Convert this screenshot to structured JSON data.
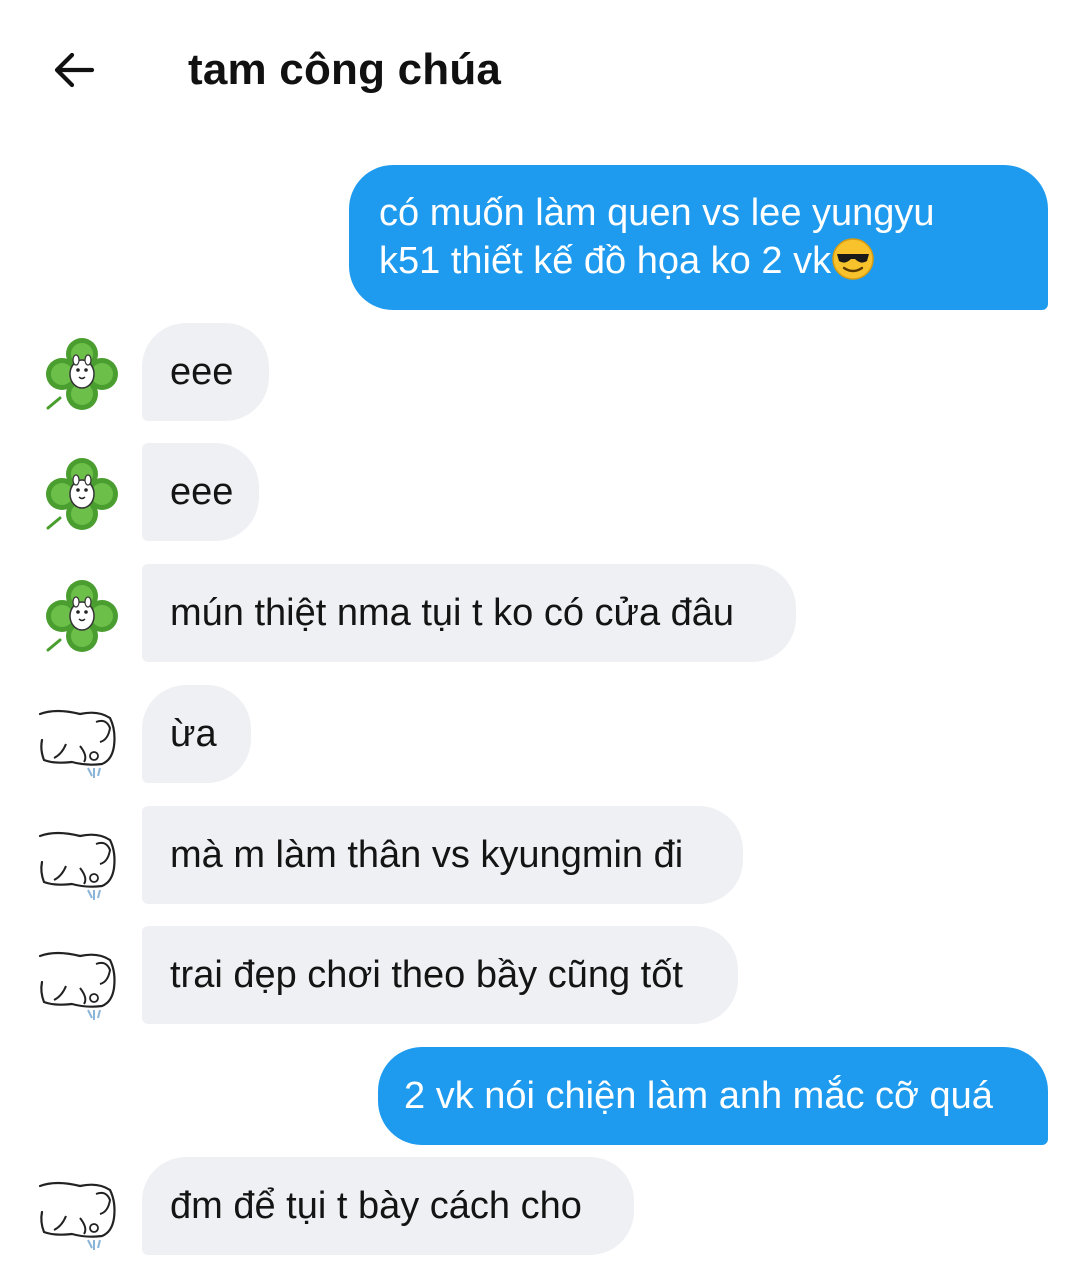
{
  "header": {
    "title": "tam công chúa",
    "back_icon": "arrow-left-icon"
  },
  "messages": [
    {
      "direction": "outgoing",
      "lines": [
        "có muốn làm quen vs lee yungyu",
        "k51 thiết kế đồ họa ko 2 vk"
      ],
      "emoji": "smiling-face-with-sunglasses"
    },
    {
      "direction": "incoming",
      "sender_avatar": "clover-avatar",
      "text": "eee"
    },
    {
      "direction": "incoming",
      "sender_avatar": "clover-avatar",
      "text": "eee"
    },
    {
      "direction": "incoming",
      "sender_avatar": "clover-avatar",
      "text": "mún thiệt nma tụi t ko có cửa đâu"
    },
    {
      "direction": "incoming",
      "sender_avatar": "sketch-animal-avatar",
      "text": "ừa"
    },
    {
      "direction": "incoming",
      "sender_avatar": "sketch-animal-avatar",
      "text": "mà m làm thân vs kyungmin đi"
    },
    {
      "direction": "incoming",
      "sender_avatar": "sketch-animal-avatar",
      "text": "trai đẹp chơi theo bầy cũng tốt"
    },
    {
      "direction": "outgoing",
      "text": "2 vk nói chiện làm anh mắc cỡ quá"
    },
    {
      "direction": "incoming",
      "sender_avatar": "sketch-animal-avatar",
      "text": "đm để tụi t bày cách cho"
    }
  ],
  "colors": {
    "outgoing_bubble": "#1e9bef",
    "incoming_bubble": "#eef0f3",
    "background": "#ffffff"
  }
}
